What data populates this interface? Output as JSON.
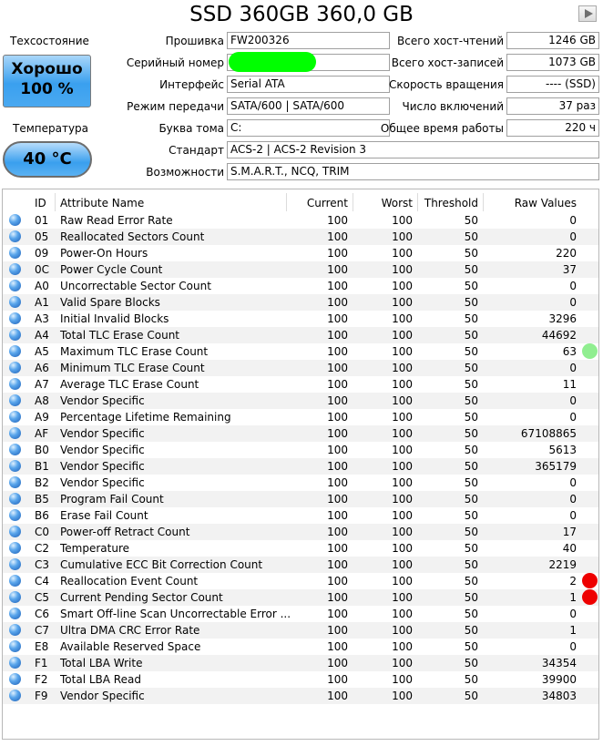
{
  "title": "SSD 360GB 360,0 GB",
  "left": {
    "health_label": "Техсостояние",
    "health_status": "Хорошо",
    "health_percent": "100 %",
    "health_color": "#3aa0ef",
    "temp_label": "Температура",
    "temp_value": "40 °C"
  },
  "info": {
    "firmware_label": "Прошивка",
    "firmware": "FW200326",
    "serial_label": "Серийный номер",
    "serial": "",
    "interface_label": "Интерфейс",
    "interface": "Serial ATA",
    "transfer_label": "Режим передачи",
    "transfer": "SATA/600 | SATA/600",
    "drive_label": "Буква тома",
    "drive": "C:",
    "standard_label": "Стандарт",
    "standard": "ACS-2 | ACS-2 Revision 3",
    "features_label": "Возможности",
    "features": "S.M.A.R.T., NCQ, TRIM"
  },
  "stats": {
    "reads_label": "Всего хост-чтений",
    "reads": "1246 GB",
    "writes_label": "Всего хост-записей",
    "writes": "1073 GB",
    "rpm_label": "Скорость вращения",
    "rpm": "---- (SSD)",
    "power_count_label": "Число включений",
    "power_count": "37 раз",
    "power_hours_label": "Общее время работы",
    "power_hours": "220 ч"
  },
  "table": {
    "headers": [
      "ID",
      "Attribute Name",
      "Current",
      "Worst",
      "Threshold",
      "Raw Values"
    ],
    "rows": [
      [
        "01",
        "Raw Read Error Rate",
        "100",
        "100",
        "50",
        "0"
      ],
      [
        "05",
        "Reallocated Sectors Count",
        "100",
        "100",
        "50",
        "0"
      ],
      [
        "09",
        "Power-On Hours",
        "100",
        "100",
        "50",
        "220"
      ],
      [
        "0C",
        "Power Cycle Count",
        "100",
        "100",
        "50",
        "37"
      ],
      [
        "A0",
        "Uncorrectable Sector Count",
        "100",
        "100",
        "50",
        "0"
      ],
      [
        "A1",
        "Valid Spare Blocks",
        "100",
        "100",
        "50",
        "0"
      ],
      [
        "A3",
        "Initial Invalid Blocks",
        "100",
        "100",
        "50",
        "3296"
      ],
      [
        "A4",
        "Total TLC Erase Count",
        "100",
        "100",
        "50",
        "44692"
      ],
      [
        "A5",
        "Maximum TLC Erase Count",
        "100",
        "100",
        "50",
        "63"
      ],
      [
        "A6",
        "Minimum TLC Erase Count",
        "100",
        "100",
        "50",
        "0"
      ],
      [
        "A7",
        "Average TLC Erase Count",
        "100",
        "100",
        "50",
        "11"
      ],
      [
        "A8",
        "Vendor Specific",
        "100",
        "100",
        "50",
        "0"
      ],
      [
        "A9",
        "Percentage Lifetime Remaining",
        "100",
        "100",
        "50",
        "0"
      ],
      [
        "AF",
        "Vendor Specific",
        "100",
        "100",
        "50",
        "67108865"
      ],
      [
        "B0",
        "Vendor Specific",
        "100",
        "100",
        "50",
        "5613"
      ],
      [
        "B1",
        "Vendor Specific",
        "100",
        "100",
        "50",
        "365179"
      ],
      [
        "B2",
        "Vendor Specific",
        "100",
        "100",
        "50",
        "0"
      ],
      [
        "B5",
        "Program Fail Count",
        "100",
        "100",
        "50",
        "0"
      ],
      [
        "B6",
        "Erase Fail Count",
        "100",
        "100",
        "50",
        "0"
      ],
      [
        "C0",
        "Power-off Retract Count",
        "100",
        "100",
        "50",
        "17"
      ],
      [
        "C2",
        "Temperature",
        "100",
        "100",
        "50",
        "40"
      ],
      [
        "C3",
        "Cumulative ECC Bit Correction Count",
        "100",
        "100",
        "50",
        "2219"
      ],
      [
        "C4",
        "Reallocation Event Count",
        "100",
        "100",
        "50",
        "2"
      ],
      [
        "C5",
        "Current Pending Sector Count",
        "100",
        "100",
        "50",
        "1"
      ],
      [
        "C6",
        "Smart Off-line Scan Uncorrectable Error ...",
        "100",
        "100",
        "50",
        "0"
      ],
      [
        "C7",
        "Ultra DMA CRC Error Rate",
        "100",
        "100",
        "50",
        "1"
      ],
      [
        "E8",
        "Available Reserved Space",
        "100",
        "100",
        "50",
        "0"
      ],
      [
        "F1",
        "Total LBA Write",
        "100",
        "100",
        "50",
        "34354"
      ],
      [
        "F2",
        "Total LBA Read",
        "100",
        "100",
        "50",
        "39900"
      ],
      [
        "F9",
        "Vendor Specific",
        "100",
        "100",
        "50",
        "34803"
      ]
    ],
    "indicators": [
      {
        "row": 8,
        "color": "#90ee90"
      },
      {
        "row": 22,
        "color": "#ee0000"
      },
      {
        "row": 23,
        "color": "#ee0000"
      }
    ]
  }
}
